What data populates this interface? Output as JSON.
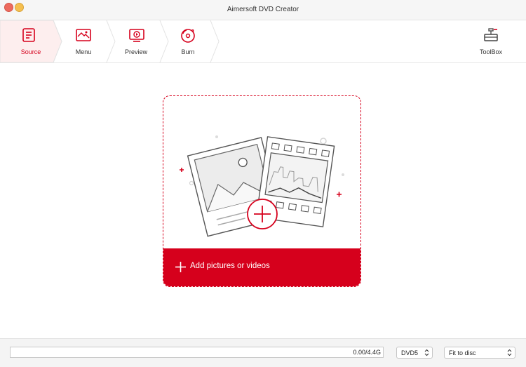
{
  "window": {
    "title": "Aimersoft DVD Creator"
  },
  "steps": [
    {
      "label": "Source",
      "icon": "source-icon",
      "active": true
    },
    {
      "label": "Menu",
      "icon": "menu-template-icon",
      "active": false
    },
    {
      "label": "Preview",
      "icon": "preview-icon",
      "active": false
    },
    {
      "label": "Burn",
      "icon": "burn-disc-icon",
      "active": false
    }
  ],
  "toolbox": {
    "label": "ToolBox",
    "icon": "toolbox-icon"
  },
  "dropzone": {
    "add_label": "Add pictures or videos",
    "icon": "plus-icon"
  },
  "status": {
    "capacity": "0.00/4.4G",
    "used_fraction": 0,
    "disc_type": "DVD5",
    "fit_mode": "Fit to disc"
  },
  "colors": {
    "accent": "#d6001c",
    "active_step_bg": "#fdeeee"
  }
}
